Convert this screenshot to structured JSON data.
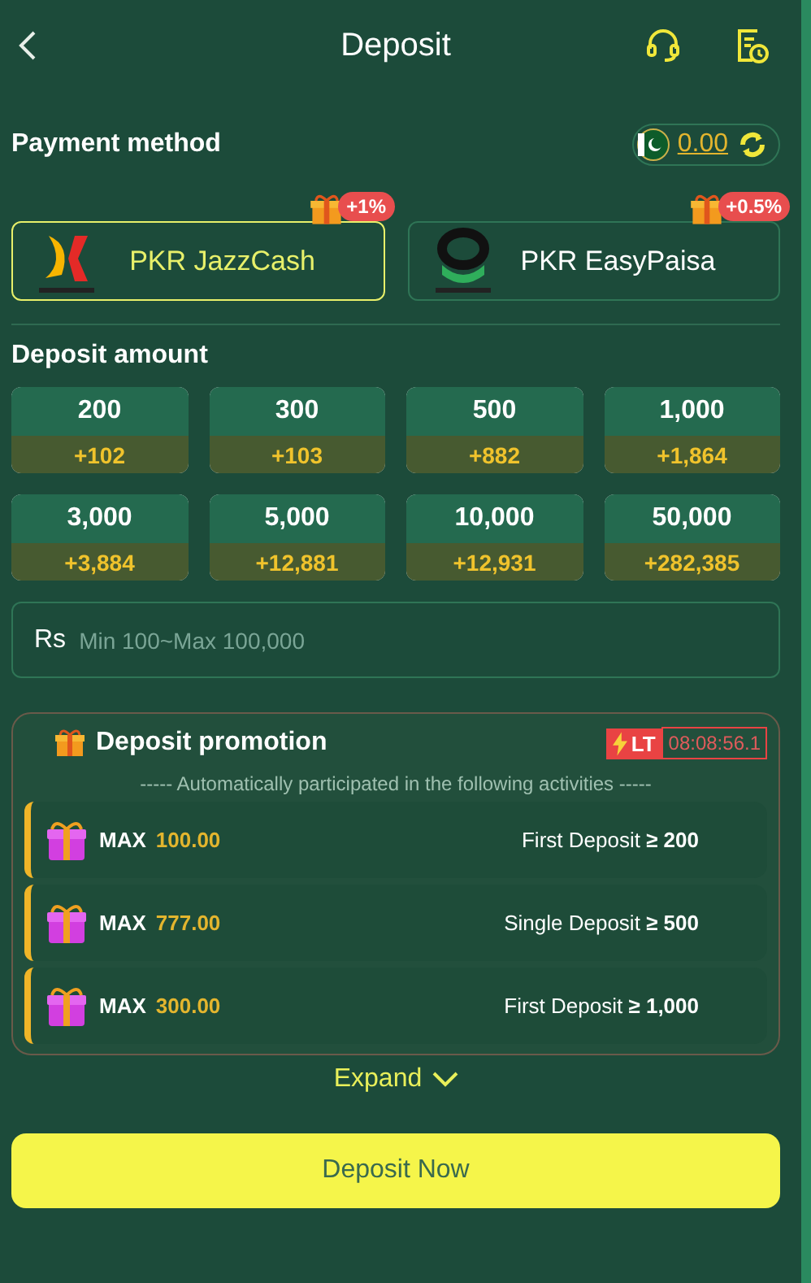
{
  "header": {
    "title": "Deposit"
  },
  "payment": {
    "label": "Payment method",
    "balance": "0.00",
    "methods": [
      {
        "name": "PKR JazzCash",
        "bonus": "+1%",
        "selected": true,
        "kind": "jazz"
      },
      {
        "name": "PKR EasyPaisa",
        "bonus": "+0.5%",
        "selected": false,
        "kind": "easy"
      }
    ]
  },
  "amount": {
    "label": "Deposit amount",
    "options": [
      {
        "amount": "200",
        "bonus": "+102"
      },
      {
        "amount": "300",
        "bonus": "+103"
      },
      {
        "amount": "500",
        "bonus": "+882"
      },
      {
        "amount": "1,000",
        "bonus": "+1,864"
      },
      {
        "amount": "3,000",
        "bonus": "+3,884"
      },
      {
        "amount": "5,000",
        "bonus": "+12,881"
      },
      {
        "amount": "10,000",
        "bonus": "+12,931"
      },
      {
        "amount": "50,000",
        "bonus": "+282,385"
      }
    ],
    "field": {
      "currency": "Rs",
      "placeholder": "Min 100~Max 100,000"
    }
  },
  "promotion": {
    "title": "Deposit promotion",
    "badge": "LT",
    "timer": "08:08:56.1",
    "subtitle": "----- Automatically participated in the following activities -----",
    "items": [
      {
        "prefix": "MAX",
        "value": "100.00",
        "condition": "First Deposit **≥ 200**"
      },
      {
        "prefix": "MAX",
        "value": "777.00",
        "condition": "Single Deposit **≥ 500**"
      },
      {
        "prefix": "MAX",
        "value": "300.00",
        "condition": "First Deposit **≥ 1,000**"
      }
    ]
  },
  "expand": "Expand",
  "submit": "Deposit Now"
}
